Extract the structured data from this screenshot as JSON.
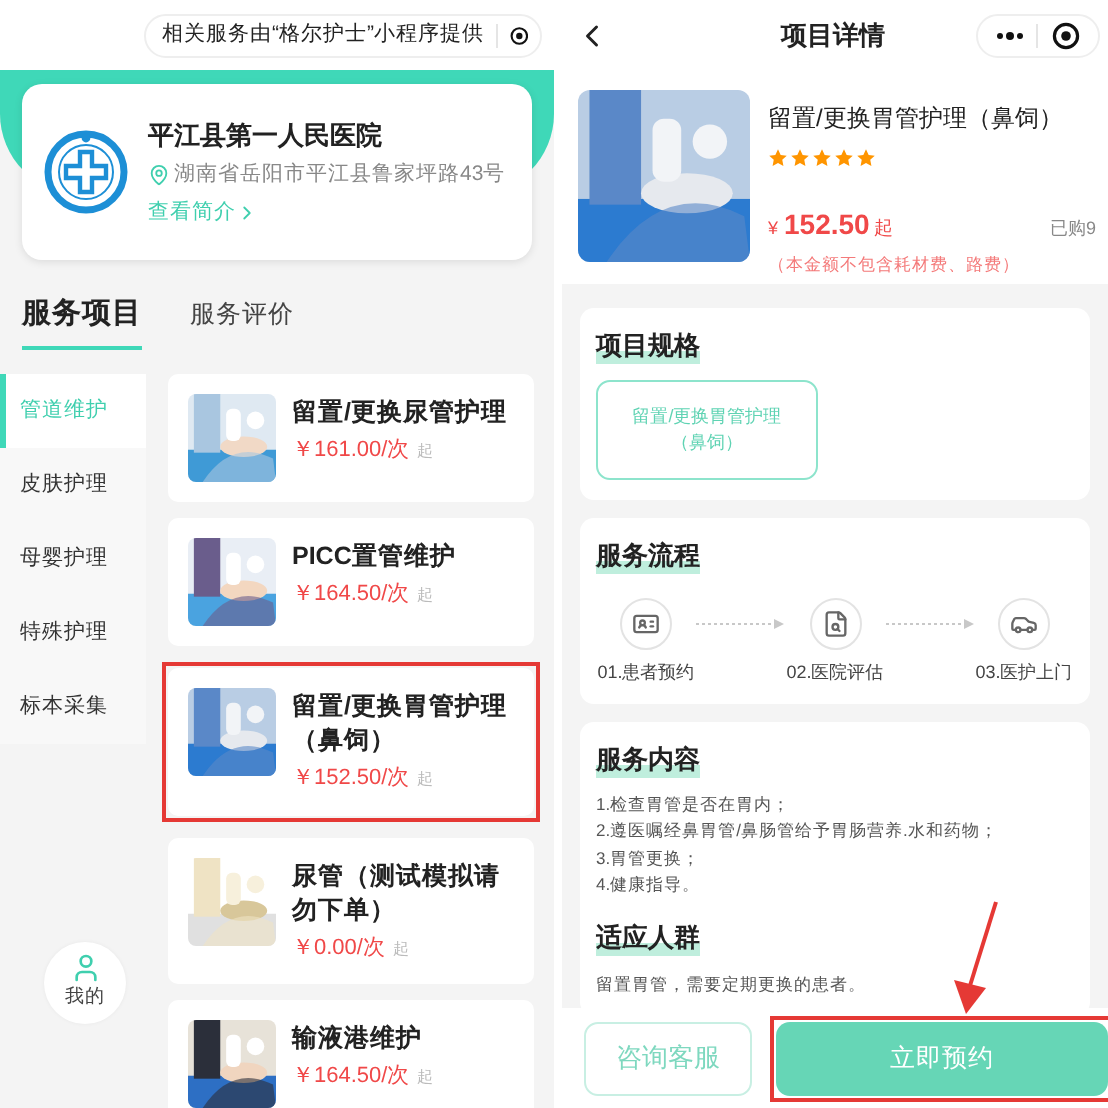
{
  "left": {
    "notice": "相关服务由“格尔护士”小程序提供",
    "hospital": {
      "name": "平江县第一人民医院",
      "address": "湖南省岳阳市平江县鲁家坪路43号",
      "link": "查看简介"
    },
    "tabs": [
      {
        "label": "服务项目",
        "selected": true
      },
      {
        "label": "服务评价",
        "selected": false
      }
    ],
    "categories": [
      {
        "label": "管道维护",
        "selected": true
      },
      {
        "label": "皮肤护理",
        "selected": false
      },
      {
        "label": "母婴护理",
        "selected": false
      },
      {
        "label": "特殊护理",
        "selected": false
      },
      {
        "label": "标本采集",
        "selected": false
      }
    ],
    "services": [
      {
        "name": "留置/更换尿管护理",
        "price": "￥161.00/次",
        "suffix": "起",
        "highlighted": false
      },
      {
        "name": "PICC置管维护",
        "price": "￥164.50/次",
        "suffix": "起",
        "highlighted": false
      },
      {
        "name": "留置/更换胃管护理（鼻饲）",
        "price": "￥152.50/次",
        "suffix": "起",
        "highlighted": true
      },
      {
        "name": "尿管（测试模拟请勿下单）",
        "price": "￥0.00/次",
        "suffix": "起",
        "highlighted": false
      },
      {
        "name": "输液港维护",
        "price": "￥164.50/次",
        "suffix": "起",
        "highlighted": false
      }
    ],
    "profile_button": "我的"
  },
  "right": {
    "title": "项目详情",
    "product": {
      "name": "留置/更换胃管护理（鼻饲）",
      "stars": 5,
      "currency": "¥",
      "price": "152.50",
      "suffix": "起",
      "sold": "已购9",
      "note": "（本金额不包含耗材费、路费）"
    },
    "spec": {
      "heading": "项目规格",
      "options": [
        {
          "label": "留置/更换胃管护理（鼻饲）",
          "selected": true
        }
      ]
    },
    "process": {
      "heading": "服务流程",
      "steps": [
        {
          "kind": "form",
          "label": "01.患者预约"
        },
        {
          "kind": "document",
          "label": "02.医院评估"
        },
        {
          "kind": "car",
          "label": "03.医护上门"
        }
      ]
    },
    "content": {
      "heading": "服务内容",
      "lines": [
        "1.检查胃管是否在胃内；",
        "2.遵医嘱经鼻胃管/鼻肠管给予胃肠营养.水和药物；",
        "3.胃管更换；",
        "4.健康指导。"
      ]
    },
    "audience": {
      "heading": "适应人群",
      "text": "留置胃管，需要定期更换的患者。"
    },
    "buttons": [
      {
        "label": "咨询客服",
        "kind": "secondary",
        "highlighted": false
      },
      {
        "label": "立即预约",
        "kind": "primary",
        "highlighted": true
      }
    ]
  }
}
